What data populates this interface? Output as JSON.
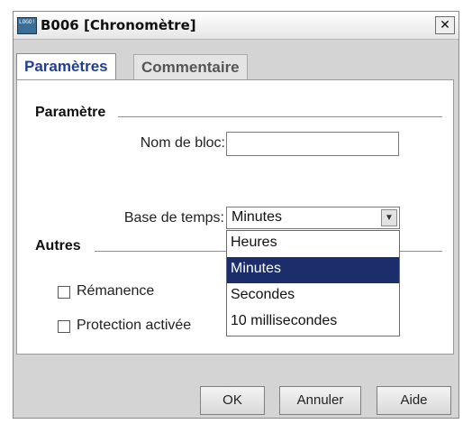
{
  "window": {
    "icon_text": "LOGO!",
    "title": "B006 [Chronomètre]",
    "close_glyph": "✕"
  },
  "tabs": [
    {
      "label": "Paramètres",
      "active": true
    },
    {
      "label": "Commentaire",
      "active": false
    }
  ],
  "parametre_section": {
    "heading": "Paramètre",
    "block_name_label": "Nom de bloc:",
    "block_name_value": "",
    "time_base_label": "Base de temps:",
    "time_base_value": "Minutes",
    "time_base_options": [
      "Heures",
      "Minutes",
      "Secondes",
      "10 millisecondes"
    ],
    "time_base_selected_index": 1
  },
  "autres_section": {
    "heading": "Autres",
    "checkboxes": [
      {
        "label": "Rémanence",
        "checked": false
      },
      {
        "label": "Protection activée",
        "checked": false
      }
    ]
  },
  "buttons": {
    "ok": "OK",
    "cancel": "Annuler",
    "help": "Aide"
  },
  "icons": {
    "app": "logo-soft-icon",
    "close": "close-icon",
    "dropdown": "chevron-down-icon"
  },
  "colors": {
    "tab_active_text": "#1f3f92",
    "selection_bg": "#1c2d6b",
    "dialog_bg": "#d4d4d4"
  }
}
